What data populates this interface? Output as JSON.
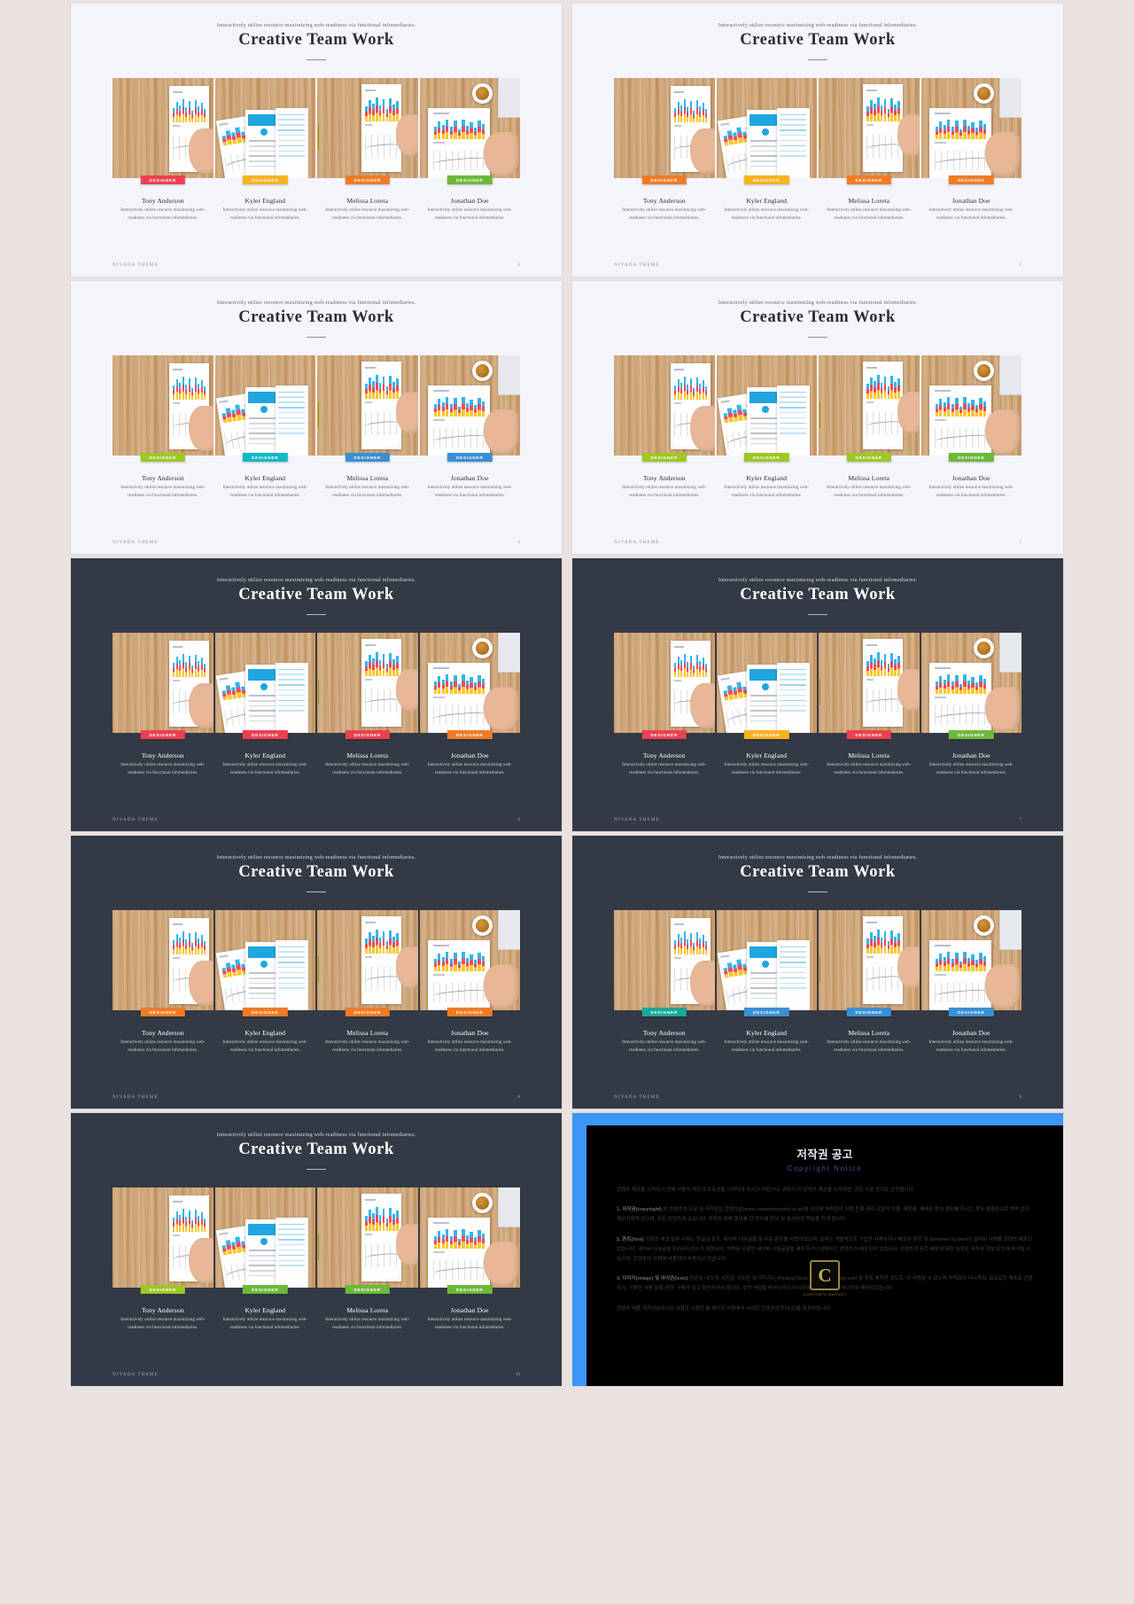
{
  "deck": {
    "brand": "NIVADA THEME",
    "kicker": "Interactively utilize resource maximizing web-readiness via functional infomediaries.",
    "title": "Creative Team Work",
    "member_desc": "Interactively utilize resource maximizing web-readiness via functional infomediaries.",
    "badge_label": "DESIGNER",
    "members": [
      {
        "name": "Tony Anderson"
      },
      {
        "name": "Kyler England"
      },
      {
        "name": "Melissa Loreta"
      },
      {
        "name": "Jonathan Doe"
      }
    ]
  },
  "slides": [
    {
      "id": "slide-1",
      "theme": "light",
      "page": "6",
      "badge_colors": [
        "#ec4050",
        "#f7b221",
        "#f07b26",
        "#6cb93a"
      ]
    },
    {
      "id": "slide-2",
      "theme": "light",
      "page": "3",
      "badge_colors": [
        "#f07b26",
        "#f7b221",
        "#f07b26",
        "#f07b26"
      ]
    },
    {
      "id": "slide-3",
      "theme": "light",
      "page": "4",
      "badge_colors": [
        "#9ec727",
        "#15b7c4",
        "#3b8fd4",
        "#3b8fd4"
      ]
    },
    {
      "id": "slide-4",
      "theme": "light",
      "page": "5",
      "badge_colors": [
        "#9ec727",
        "#9ec727",
        "#9ec727",
        "#6cb93a"
      ]
    },
    {
      "id": "slide-5",
      "theme": "dark",
      "page": "6",
      "badge_colors": [
        "#ec4050",
        "#ec4050",
        "#ec4050",
        "#f07b26"
      ]
    },
    {
      "id": "slide-6",
      "theme": "dark",
      "page": "7",
      "badge_colors": [
        "#ec4050",
        "#f7b221",
        "#ec4050",
        "#6cb93a"
      ]
    },
    {
      "id": "slide-7",
      "theme": "dark",
      "page": "8",
      "badge_colors": [
        "#f07b26",
        "#f07b26",
        "#f07b26",
        "#f07b26"
      ]
    },
    {
      "id": "slide-8",
      "theme": "dark",
      "page": "9",
      "badge_colors": [
        "#1aa89b",
        "#3b8fd4",
        "#3b8fd4",
        "#3b8fd4"
      ]
    },
    {
      "id": "slide-9",
      "theme": "dark",
      "page": "10",
      "badge_colors": [
        "#9ec727",
        "#6cb93a",
        "#6cb93a",
        "#6cb93a"
      ]
    }
  ],
  "copyright": {
    "title": "저작권 공고",
    "subtitle": "Copyright Notice",
    "intro": "콘텐츠 제공을 시작하기 전에 사용자 약관과 소유권을 시작하여 주시기 바랍니다. 귀하가 이 콘텐츠 제공을 시작하면, 것은 사용 동의로 간주됩니다.",
    "sections": [
      {
        "heading": "1. 저작권(copyright)",
        "text": "본 콘텐츠의 소유 및 저작권은 콘텐츠샵(www.contentsmarket.co.kr)에 있으며 허락없이 사용 등록 권리 고압적 이용, 재판매, 재배포 등의 행위를 하시는 경우 복제권으로 허락 없이 제공자에게 있으며, 모든 콘텐츠에 있습니다. 저작권 침해 행위를 한 경우에 민사 및 형사상의 책임을 지게 됩니다."
      },
      {
        "heading": "2. 폰트(font)",
        "text": "콘텐츠 내의 일부 서체는 한글과 폰트, 네이버 나눔글꼴 및 무료 폰트를 사용하였으며, 일부는 개별적으로 구입한 서체이거나 배포된 폰트 및 Windows System이 설치된 서체를 콘텐츠 배포되었습니다. 네이버 나눔글꼴 프리라이선스가 적용되어, 허락된 사항만 네이버 나눔글꼴을 배포하거나 판매하는 콘텐츠가 배포되어 있습니다. 콘텐츠의 폰트 배포에 대한 요청은 저작권 정보 문의에 부가될 수 있으며, 콘텐츠의 서체에 사용되어 사용되고 있습니다."
      },
      {
        "heading": "3. 이미지(image) 및 아이콘(icon)",
        "text": "콘텐츠 내의 등 사진은, 아이콘 및 이미지는 PixabayStock.com과 Freestock.com 및 직접 제작한 것으로, 이 사용될 수 있으며 허락없이 다시하여, 필요로한 배포로 콘텐츠의, 구매한 사용 유형 권한, 구매가 되고 확인하셔서 됩니다. 모양 색감을 바꾸시거나 다시하여서는 변경되지 아니하여 제작되었습니다."
      }
    ],
    "footer_note": "콘텐츠 제품 저작권심의기준 사항은 시청한 통 제이지 사항에서 사이트 콘텐츠샵까지(소)을 참조바랍니다.",
    "logo_letter": "C",
    "logo_caption": "CONTENTS MARKET"
  }
}
